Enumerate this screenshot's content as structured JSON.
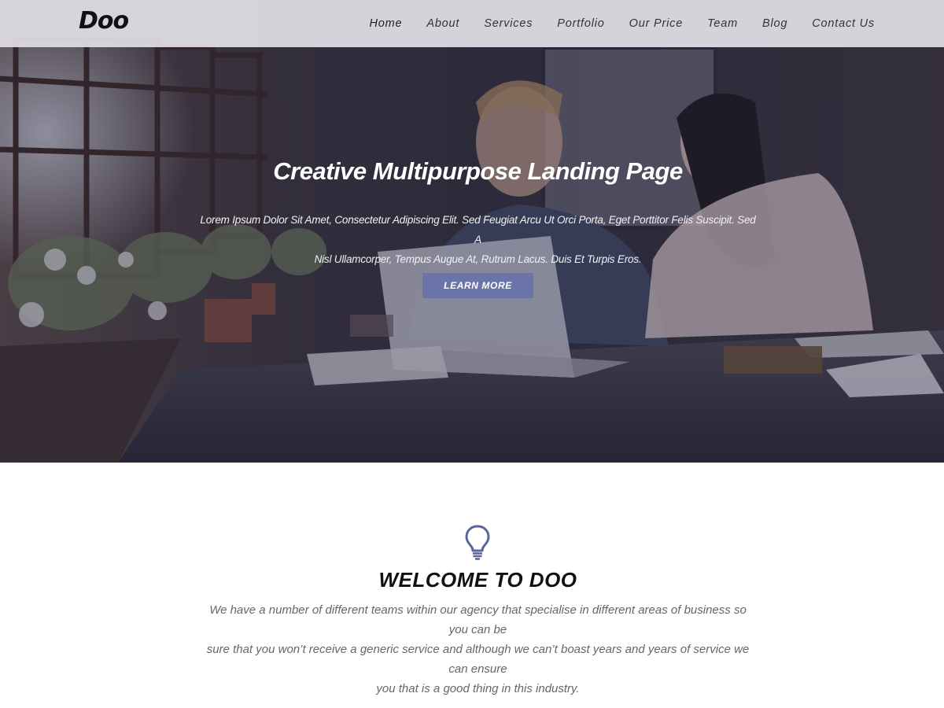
{
  "brand": {
    "logo": "Doo"
  },
  "nav": {
    "items": [
      {
        "label": "Home",
        "active": true
      },
      {
        "label": "About"
      },
      {
        "label": "Services"
      },
      {
        "label": "Portfolio"
      },
      {
        "label": "Our Price"
      },
      {
        "label": "Team"
      },
      {
        "label": "Blog"
      },
      {
        "label": "Contact Us"
      }
    ]
  },
  "hero": {
    "title": "Creative Multipurpose Landing Page",
    "text_line1": "Lorem Ipsum Dolor Sit Amet, Consectetur Adipiscing Elit. Sed Feugiat Arcu Ut Orci Porta, Eget Porttitor Felis Suscipit. Sed A",
    "text_line2": "Nisl Ullamcorper, Tempus Augue At, Rutrum Lacus. Duis Et Turpis Eros.",
    "button_label": "LEARN MORE",
    "image": "people-working-at-laptop-photo"
  },
  "welcome": {
    "icon": "lightbulb-icon",
    "title": "WELCOME TO DOO",
    "text_line1": "We have a number of different teams within our agency that specialise in different areas of business so you can be",
    "text_line2": "sure that you won’t receive a generic service and although we can’t boast years and years of service we can ensure",
    "text_line3": "you that is a good thing in this industry."
  },
  "colors": {
    "accent": "#6a74a8",
    "icon": "#5a6699",
    "nav_bg": "#ebebf0",
    "hero_overlay": "#28284a"
  }
}
